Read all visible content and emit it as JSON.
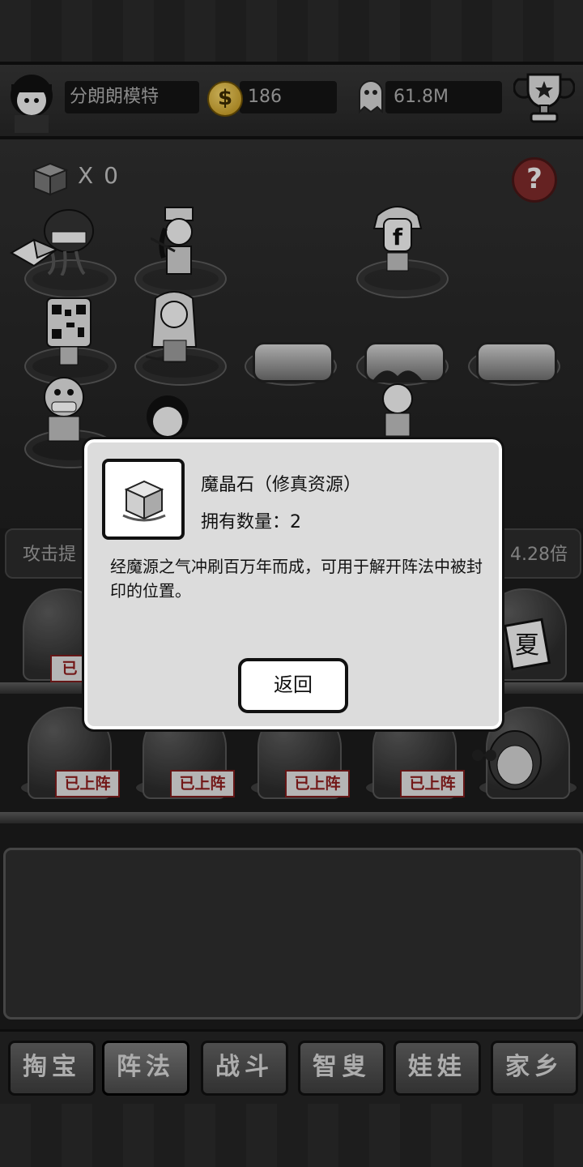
{
  "header": {
    "player_name": "分朗朗模特",
    "coins": "186",
    "souls": "61.8M"
  },
  "arena": {
    "cube_count_label": "X 0",
    "help_label": "?"
  },
  "attack": {
    "label": "攻击提",
    "multiplier": "4.28倍"
  },
  "slot_sign_label": "已上阵",
  "dialog": {
    "item_name": "魔晶石（修真资源）",
    "quantity_label": "拥有数量：2",
    "description": "经魔源之气冲刷百万年而成，可用于解开阵法中被封印的位置。",
    "back_label": "返回"
  },
  "nav": {
    "tabs": [
      {
        "label": "掏宝"
      },
      {
        "label": "阵法"
      },
      {
        "label": "战斗"
      },
      {
        "label": "智叟"
      },
      {
        "label": "娃娃"
      },
      {
        "label": "家乡"
      }
    ],
    "active_tab": "阵法"
  },
  "colors": {
    "help_button": "#7c2a2a",
    "sign_text": "#8b1d1d",
    "coin": "#d9b23a"
  }
}
